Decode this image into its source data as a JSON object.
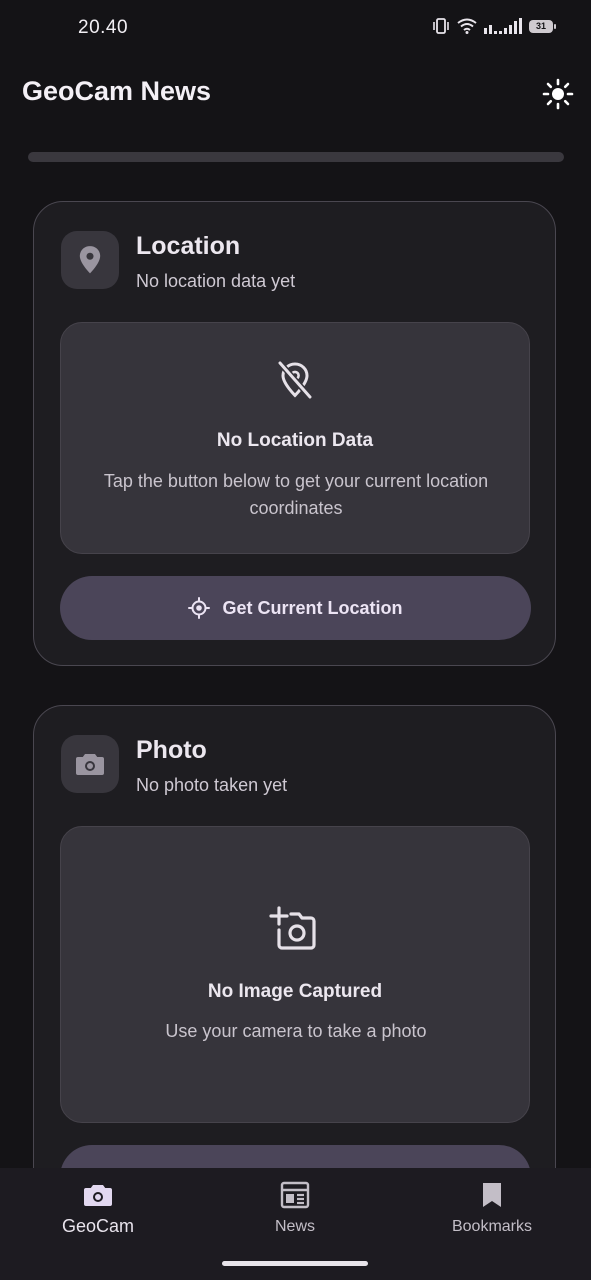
{
  "status_bar": {
    "time": "20.40",
    "battery": "31"
  },
  "app_bar": {
    "title": "GeoCam News",
    "theme_icon": "sun-icon"
  },
  "location_card": {
    "title": "Location",
    "subtitle": "No location data yet",
    "icon": "location-pin-icon",
    "empty_icon": "location-off-icon",
    "empty_title": "No Location Data",
    "empty_desc": "Tap the button below to get your current location coordinates",
    "button_icon": "gps-target-icon",
    "button_label": "Get Current Location"
  },
  "photo_card": {
    "title": "Photo",
    "subtitle": "No photo taken yet",
    "icon": "camera-icon",
    "empty_icon": "add-photo-icon",
    "empty_title": "No Image Captured",
    "empty_desc": "Use your camera to take a photo"
  },
  "bottom_nav": {
    "items": [
      {
        "label": "GeoCam",
        "icon": "camera-icon",
        "active": true
      },
      {
        "label": "News",
        "icon": "newspaper-icon",
        "active": false
      },
      {
        "label": "Bookmarks",
        "icon": "bookmark-icon",
        "active": false
      }
    ]
  },
  "colors": {
    "background": "#141316",
    "card": "#1e1d21",
    "button": "#4b4559",
    "accent_text": "#ece4f4"
  }
}
